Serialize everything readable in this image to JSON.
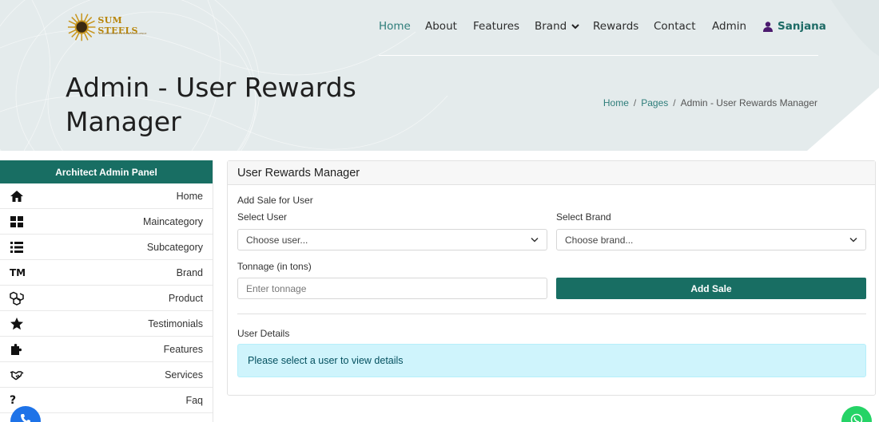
{
  "brand": {
    "name": "SUM STEELS",
    "tagline": "A COMMITMENT TO STEEL EXCELLENCE"
  },
  "nav": {
    "items": [
      "Home",
      "About",
      "Features",
      "Brand",
      "Rewards",
      "Contact",
      "Admin"
    ],
    "active": "Home",
    "user": "Sanjana"
  },
  "hero": {
    "title": "Admin - User Rewards Manager",
    "breadcrumb": [
      "Home",
      "Pages",
      "Admin - User Rewards Manager"
    ]
  },
  "sidebar": {
    "title": "Architect Admin Panel",
    "items": [
      {
        "label": "Home",
        "icon": "home-icon"
      },
      {
        "label": "Maincategory",
        "icon": "grid-icon"
      },
      {
        "label": "Subcategory",
        "icon": "list-icon"
      },
      {
        "label": "Brand",
        "icon": "trademark-icon",
        "glyph": "TM"
      },
      {
        "label": "Product",
        "icon": "boxes-icon"
      },
      {
        "label": "Testimonials",
        "icon": "star-icon"
      },
      {
        "label": "Features",
        "icon": "puzzle-icon"
      },
      {
        "label": "Services",
        "icon": "handshake-icon"
      },
      {
        "label": "Faq",
        "icon": "question-icon",
        "glyph": "?"
      }
    ]
  },
  "manager": {
    "title": "User Rewards Manager",
    "section_add": "Add Sale for User",
    "select_user_label": "Select User",
    "select_user_placeholder": "Choose user...",
    "select_brand_label": "Select Brand",
    "select_brand_placeholder": "Choose brand...",
    "tonnage_label": "Tonnage (in tons)",
    "tonnage_placeholder": "Enter tonnage",
    "add_button": "Add Sale",
    "details_label": "User Details",
    "details_message": "Please select a user to view details"
  },
  "colors": {
    "primary": "#186e63",
    "accent": "#2e7d7a",
    "hero_bg": "#e4ebec",
    "info_bg": "#cff4fc"
  }
}
